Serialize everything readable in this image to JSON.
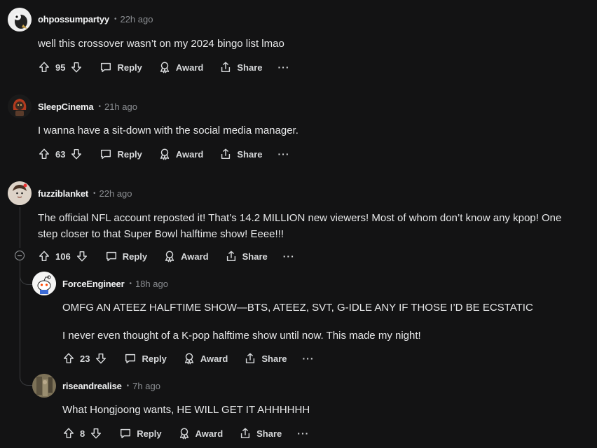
{
  "labels": {
    "reply": "Reply",
    "award": "Award",
    "share": "Share",
    "more": "···"
  },
  "comments": [
    {
      "author": "ohpossumpartyy",
      "separator": "•",
      "time": "22h ago",
      "body": [
        "well this crossover wasn’t on my 2024 bingo list lmao"
      ],
      "score": "95"
    },
    {
      "author": "SleepCinema",
      "separator": "•",
      "time": "21h ago",
      "body": [
        "I wanna have a sit-down with the social media manager."
      ],
      "score": "63"
    },
    {
      "author": "fuzziblanket",
      "separator": "•",
      "time": "22h ago",
      "body": [
        "The official NFL account reposted it! That’s 14.2 MILLION new viewers! Most of whom don’t know any kpop! One step closer to that Super Bowl halftime show! Eeee!!!"
      ],
      "score": "106"
    },
    {
      "author": "ForceEngineer",
      "separator": "•",
      "time": "18h ago",
      "body": [
        "OMFG AN ATEEZ HALFTIME SHOW—BTS, ATEEZ, SVT, G-IDLE ANY IF THOSE I’D BE ECSTATIC",
        "I never even thought of a K-pop halftime show until now. This made my night!"
      ],
      "score": "23"
    },
    {
      "author": "riseandrealise",
      "separator": "•",
      "time": "7h ago",
      "body": [
        "What Hongjoong wants, HE WILL GET IT AHHHHHH"
      ],
      "score": "8"
    }
  ],
  "icons": {
    "upvote": "arrow-up-icon",
    "downvote": "arrow-down-icon",
    "reply": "speech-bubble-icon",
    "award": "award-ribbon-icon",
    "share": "share-icon",
    "collapse": "collapse-minus-icon"
  },
  "colors": {
    "background": "#131314",
    "text": "#e8e9ea",
    "muted": "#8a8d91",
    "thread": "#3a3c3f"
  }
}
